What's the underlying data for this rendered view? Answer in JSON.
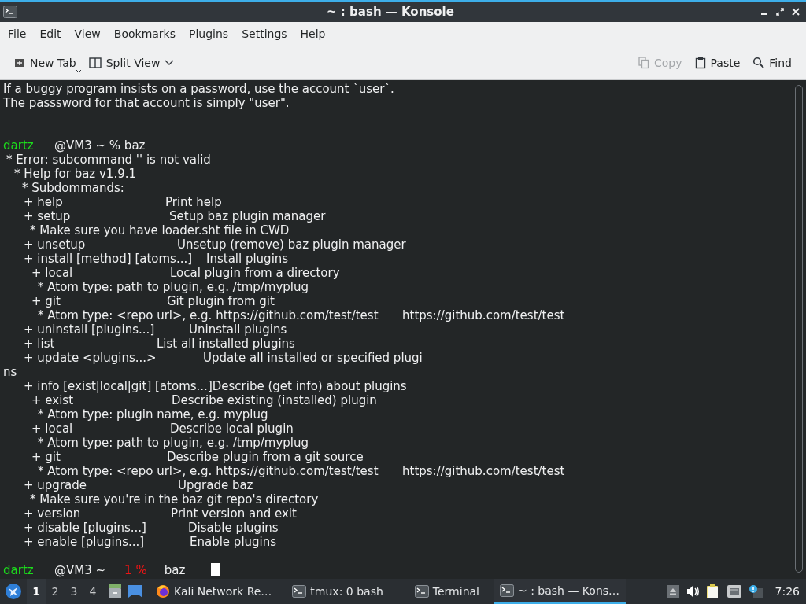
{
  "window": {
    "title": "~ : bash — Konsole"
  },
  "menu": [
    "File",
    "Edit",
    "View",
    "Bookmarks",
    "Plugins",
    "Settings",
    "Help"
  ],
  "toolbar": [
    {
      "kind": "new-tab",
      "label": "New Tab",
      "disabled": false
    },
    {
      "kind": "split",
      "label": "Split View",
      "disabled": false
    },
    {
      "kind": "copy",
      "label": "Copy",
      "disabled": true
    },
    {
      "kind": "paste",
      "label": "Paste",
      "disabled": false
    },
    {
      "kind": "find",
      "label": "Find",
      "disabled": false
    }
  ],
  "terminal": {
    "lines": [
      {
        "kind": "text",
        "text": "If a buggy program insists on a password, use the account `user`."
      },
      {
        "kind": "text",
        "text": "The passsword for that account is simply \"user\"."
      },
      {
        "kind": "prompt",
        "user": "dartz",
        "host": "@VM3 ~ % baz"
      },
      {
        "kind": "text",
        "text": "* Error: subcommand '' is not valid"
      },
      {
        "kind": "text",
        "text": "* Help for baz v1.9.1"
      },
      {
        "kind": "text",
        "text": "* Subdommands:"
      },
      {
        "kind": "text",
        "text": "+ help",
        "desc": "Print help"
      },
      {
        "kind": "text",
        "text": "+ setup",
        "desc": "Setup baz plugin manager"
      },
      {
        "kind": "text",
        "text": "* Make sure you have loader.sht file in CWD"
      },
      {
        "kind": "text",
        "text": "+ unsetup",
        "desc": "Unsetup (remove) baz plugin manager"
      },
      {
        "kind": "text",
        "text": "+ install [method] [atoms...]",
        "desc": "Install plugins"
      },
      {
        "kind": "text",
        "text": "+ local",
        "desc": "Local plugin from a directory"
      },
      {
        "kind": "text",
        "text": "* Atom type: path to plugin, e.g. /tmp/myplug"
      },
      {
        "kind": "text",
        "text": "+ git",
        "desc": "Git plugin from git"
      },
      {
        "kind": "text",
        "text": "* Atom type: <repo url>, e.g. https://github.com/test/test",
        "desc": "https://github.com/test/test"
      },
      {
        "kind": "text",
        "text": "+ uninstall [plugins...]",
        "desc": "Uninstall plugins"
      },
      {
        "kind": "text",
        "text": "+ list",
        "desc": "List all installed plugins"
      },
      {
        "kind": "text",
        "text": "+ update <plugins...>",
        "desc": "Update all installed or specified plugi"
      },
      {
        "kind": "text",
        "text": "ns"
      },
      {
        "kind": "text",
        "text": "+ info [exist|local|git] [atoms...]Describe (get info) about plugins"
      },
      {
        "kind": "text",
        "text": "+ exist",
        "desc": "Describe existing (installed) plugin"
      },
      {
        "kind": "text",
        "text": "* Atom type: plugin name, e.g. myplug"
      },
      {
        "kind": "text",
        "text": "+ local",
        "desc": "Describe local plugin"
      },
      {
        "kind": "text",
        "text": "* Atom type: path to plugin, e.g. /tmp/myplug"
      },
      {
        "kind": "text",
        "text": "+ git",
        "desc": "Describe plugin from a git source"
      },
      {
        "kind": "text",
        "text": "* Atom type: <repo url>, e.g. https://github.com/test/test",
        "desc": "https://github.com/test/test"
      },
      {
        "kind": "text",
        "text": "+ upgrade",
        "desc": "Upgrade baz"
      },
      {
        "kind": "text",
        "text": "* Make sure you're in the baz git repo's directory"
      },
      {
        "kind": "text",
        "text": "+ version",
        "desc": "Print version and exit"
      },
      {
        "kind": "text",
        "text": "+ disable [plugins...]",
        "desc": "Disable plugins"
      },
      {
        "kind": "text",
        "text": "+ enable [plugins...]",
        "desc": "Enable plugins"
      },
      {
        "kind": "prompt",
        "user": "dartz",
        "host": "@VM3 ~",
        "status": "1 %",
        "command": "baz",
        "cursor": true
      }
    ]
  },
  "taskbar": {
    "workspaces": [
      {
        "label": "1",
        "selected": true
      },
      {
        "label": "2",
        "selected": false
      },
      {
        "label": "3",
        "selected": false
      },
      {
        "label": "4",
        "selected": false
      }
    ],
    "tasks": [
      {
        "kind": "browser",
        "label": "Kali Network Re…",
        "selected": false
      },
      {
        "kind": "terminal",
        "label": "tmux: 0 bash",
        "selected": false
      },
      {
        "kind": "terminal",
        "label": "Terminal",
        "selected": false
      },
      {
        "kind": "terminal",
        "label": "~ : bash — Kons…",
        "selected": true
      }
    ],
    "clock": "7:26"
  }
}
